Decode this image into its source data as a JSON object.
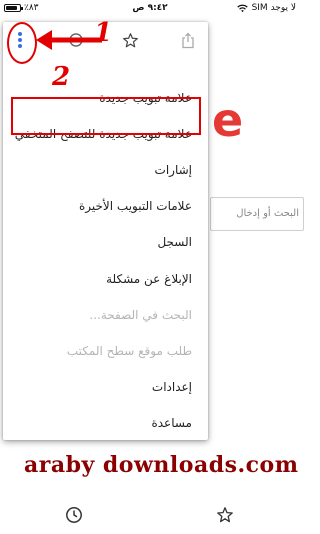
{
  "status_bar": {
    "battery_text": "٪٨٣",
    "battery_level": 0.83,
    "time": "٩:٤٢ ص",
    "carrier": "لا يوجد SIM"
  },
  "background_page": {
    "logo_fragment": "e",
    "search_placeholder": "البحث أو إدخال"
  },
  "menu": {
    "top_icons": [
      "more-vertical-icon",
      "forward-icon",
      "star-icon",
      "share-icon"
    ],
    "items": [
      {
        "label": "علامة تبويب جديدة",
        "enabled": true
      },
      {
        "label": "علامة تبويب جديدة للتصفح المتخفي",
        "enabled": true,
        "highlighted": true
      },
      {
        "label": "إشارات",
        "enabled": true
      },
      {
        "label": "علامات التبويب الأخيرة",
        "enabled": true
      },
      {
        "label": "السجل",
        "enabled": true
      },
      {
        "label": "الإبلاغ عن مشكلة",
        "enabled": true
      },
      {
        "label": "البحث في الصفحة...",
        "enabled": false
      },
      {
        "label": "طلب موقع سطح المكتب",
        "enabled": false
      },
      {
        "label": "إعدادات",
        "enabled": true
      },
      {
        "label": "مساعدة",
        "enabled": true
      }
    ]
  },
  "annotations": {
    "number_1": "1",
    "number_2": "2",
    "color": "#e30000"
  },
  "watermark": "araby downloads.com",
  "bottom_bar": {
    "icons": [
      "history-icon",
      "star-icon"
    ]
  }
}
